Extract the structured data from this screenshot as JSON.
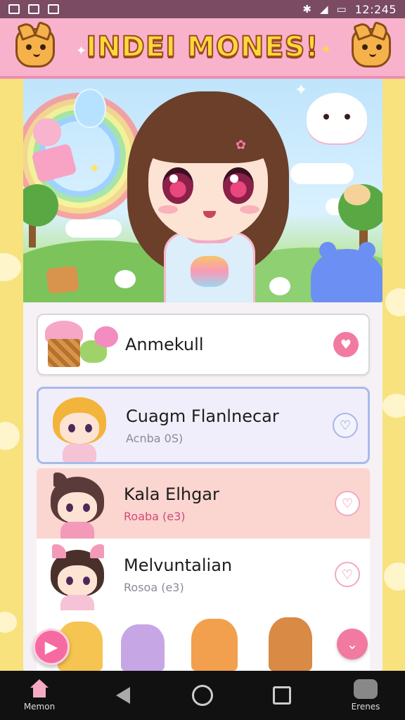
{
  "status_bar": {
    "time": "12:245",
    "left_icons": [
      "image-icon",
      "grid-icon",
      "signal-icon"
    ],
    "right_icons": [
      "bluetooth-icon",
      "wifi-icon",
      "battery-icon"
    ]
  },
  "header": {
    "title": "INDEI MONES!"
  },
  "list": {
    "items": [
      {
        "name": "Anmekull",
        "sub": "",
        "heart": "filled"
      },
      {
        "name": "Cuagm Flanlnecar",
        "sub": "Acnba 0S)",
        "heart": "outline"
      },
      {
        "name": "Kala Elhgar",
        "sub": "Roaba (e3)",
        "heart": "outline"
      },
      {
        "name": "Melvuntalian",
        "sub": "Rosoa (e3)",
        "heart": "outline"
      }
    ]
  },
  "bottom_nav": {
    "home_label": "Memon",
    "scenes_label": "Erenes"
  },
  "colors": {
    "header_pink": "#f9b2cc",
    "title_yellow": "#ffd93b",
    "accent_pink": "#f27aa1",
    "background_yellow": "#f7e27e",
    "selected_border": "#a9b9ea"
  }
}
